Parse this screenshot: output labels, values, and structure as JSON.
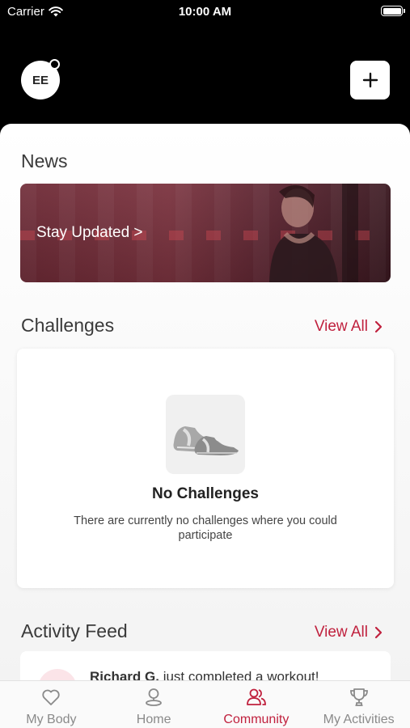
{
  "status_bar": {
    "carrier": "Carrier",
    "time": "10:00 AM"
  },
  "header": {
    "avatar_initials": "EE",
    "add_icon": "plus-icon"
  },
  "news": {
    "title": "News",
    "banner_text": "Stay Updated >"
  },
  "challenges": {
    "title": "Challenges",
    "view_all": "View All",
    "empty_icon": "sneaker-icon",
    "empty_title": "No Challenges",
    "empty_description": "There are currently no challenges where you could participate"
  },
  "activity_feed": {
    "title": "Activity Feed",
    "view_all": "View All",
    "items": [
      {
        "name": "Richard G.",
        "text": "just completed a workout!"
      }
    ]
  },
  "tabs": [
    {
      "label": "My Body",
      "icon": "heart-icon",
      "active": false
    },
    {
      "label": "Home",
      "icon": "location-pin-icon",
      "active": false
    },
    {
      "label": "Community",
      "icon": "users-icon",
      "active": true
    },
    {
      "label": "My Activities",
      "icon": "trophy-icon",
      "active": false
    }
  ],
  "colors": {
    "accent": "#c0213e",
    "header_bg": "#000000",
    "tab_inactive": "#8a8a8a"
  }
}
